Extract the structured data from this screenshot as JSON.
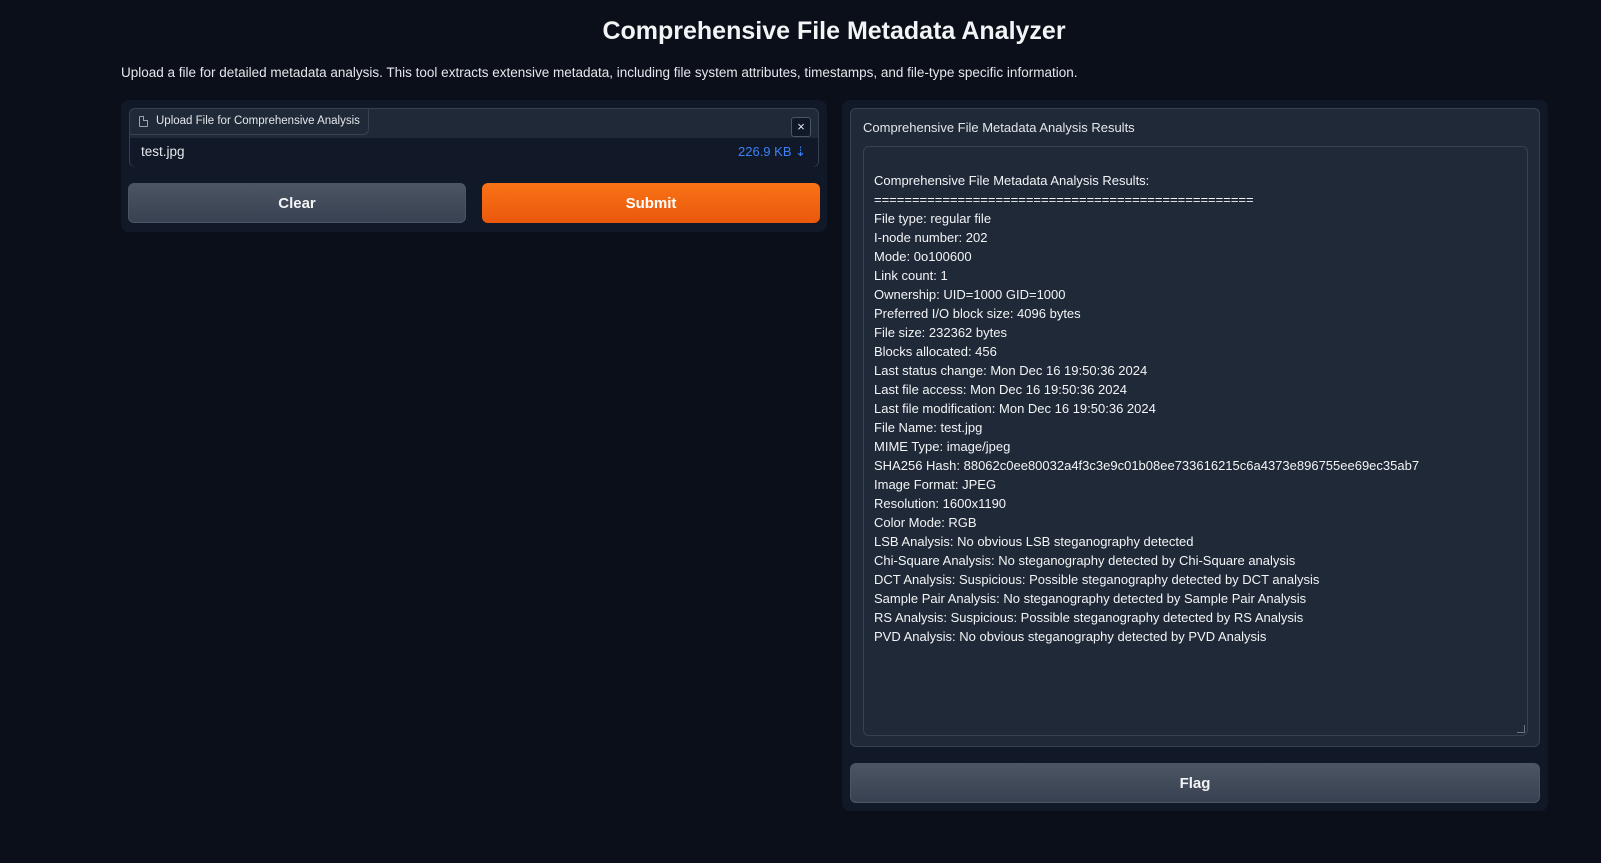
{
  "header": {
    "title": "Comprehensive File Metadata Analyzer",
    "description": "Upload a file for detailed metadata analysis. This tool extracts extensive metadata, including file system attributes, timestamps, and file-type specific information."
  },
  "upload": {
    "label": "Upload File for Comprehensive Analysis",
    "file_name": "test.jpg",
    "file_size": "226.9 KB ⇣",
    "close_symbol": "×"
  },
  "buttons": {
    "clear": "Clear",
    "submit": "Submit",
    "flag": "Flag"
  },
  "results": {
    "label": "Comprehensive File Metadata Analysis Results",
    "lines": [
      "Comprehensive File Metadata Analysis Results:",
      "==================================================",
      "File type: regular file",
      "I-node number: 202",
      "Mode: 0o100600",
      "Link count: 1",
      "Ownership: UID=1000 GID=1000",
      "Preferred I/O block size: 4096 bytes",
      "File size: 232362 bytes",
      "Blocks allocated: 456",
      "Last status change: Mon Dec 16 19:50:36 2024",
      "Last file access: Mon Dec 16 19:50:36 2024",
      "Last file modification: Mon Dec 16 19:50:36 2024",
      "File Name: test.jpg",
      "MIME Type: image/jpeg",
      "SHA256 Hash: 88062c0ee80032a4f3c3e9c01b08ee733616215c6a4373e896755ee69ec35ab7",
      "Image Format: JPEG",
      "Resolution: 1600x1190",
      "Color Mode: RGB",
      "LSB Analysis: No obvious LSB steganography detected",
      "Chi-Square Analysis: No steganography detected by Chi-Square analysis",
      "DCT Analysis: Suspicious: Possible steganography detected by DCT analysis",
      "Sample Pair Analysis: No steganography detected by Sample Pair Analysis",
      "RS Analysis: Suspicious: Possible steganography detected by RS Analysis",
      "PVD Analysis: No obvious steganography detected by PVD Analysis"
    ]
  },
  "colors": {
    "background": "#0b0f19",
    "panel": "#111827",
    "accent_orange": "#f97316",
    "file_size_blue": "#3b82f6"
  },
  "icons": {
    "upload_label_icon": "file-icon",
    "close": "close-icon",
    "download": "download-arrow-icon"
  }
}
